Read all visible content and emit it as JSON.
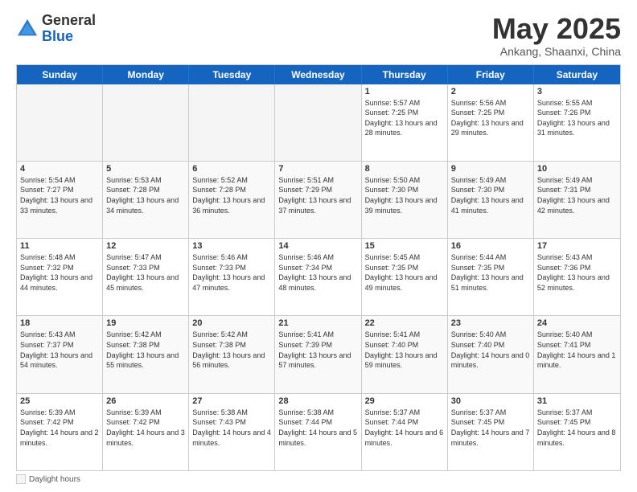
{
  "logo": {
    "general": "General",
    "blue": "Blue"
  },
  "title": "May 2025",
  "subtitle": "Ankang, Shaanxi, China",
  "dayHeaders": [
    "Sunday",
    "Monday",
    "Tuesday",
    "Wednesday",
    "Thursday",
    "Friday",
    "Saturday"
  ],
  "legend": "Daylight hours",
  "weeks": [
    [
      {
        "day": "",
        "info": "",
        "empty": true
      },
      {
        "day": "",
        "info": "",
        "empty": true
      },
      {
        "day": "",
        "info": "",
        "empty": true
      },
      {
        "day": "",
        "info": "",
        "empty": true
      },
      {
        "day": "1",
        "info": "Sunrise: 5:57 AM\nSunset: 7:25 PM\nDaylight: 13 hours\nand 28 minutes."
      },
      {
        "day": "2",
        "info": "Sunrise: 5:56 AM\nSunset: 7:25 PM\nDaylight: 13 hours\nand 29 minutes."
      },
      {
        "day": "3",
        "info": "Sunrise: 5:55 AM\nSunset: 7:26 PM\nDaylight: 13 hours\nand 31 minutes."
      }
    ],
    [
      {
        "day": "4",
        "info": "Sunrise: 5:54 AM\nSunset: 7:27 PM\nDaylight: 13 hours\nand 33 minutes."
      },
      {
        "day": "5",
        "info": "Sunrise: 5:53 AM\nSunset: 7:28 PM\nDaylight: 13 hours\nand 34 minutes."
      },
      {
        "day": "6",
        "info": "Sunrise: 5:52 AM\nSunset: 7:28 PM\nDaylight: 13 hours\nand 36 minutes."
      },
      {
        "day": "7",
        "info": "Sunrise: 5:51 AM\nSunset: 7:29 PM\nDaylight: 13 hours\nand 37 minutes."
      },
      {
        "day": "8",
        "info": "Sunrise: 5:50 AM\nSunset: 7:30 PM\nDaylight: 13 hours\nand 39 minutes."
      },
      {
        "day": "9",
        "info": "Sunrise: 5:49 AM\nSunset: 7:30 PM\nDaylight: 13 hours\nand 41 minutes."
      },
      {
        "day": "10",
        "info": "Sunrise: 5:49 AM\nSunset: 7:31 PM\nDaylight: 13 hours\nand 42 minutes."
      }
    ],
    [
      {
        "day": "11",
        "info": "Sunrise: 5:48 AM\nSunset: 7:32 PM\nDaylight: 13 hours\nand 44 minutes."
      },
      {
        "day": "12",
        "info": "Sunrise: 5:47 AM\nSunset: 7:33 PM\nDaylight: 13 hours\nand 45 minutes."
      },
      {
        "day": "13",
        "info": "Sunrise: 5:46 AM\nSunset: 7:33 PM\nDaylight: 13 hours\nand 47 minutes."
      },
      {
        "day": "14",
        "info": "Sunrise: 5:46 AM\nSunset: 7:34 PM\nDaylight: 13 hours\nand 48 minutes."
      },
      {
        "day": "15",
        "info": "Sunrise: 5:45 AM\nSunset: 7:35 PM\nDaylight: 13 hours\nand 49 minutes."
      },
      {
        "day": "16",
        "info": "Sunrise: 5:44 AM\nSunset: 7:35 PM\nDaylight: 13 hours\nand 51 minutes."
      },
      {
        "day": "17",
        "info": "Sunrise: 5:43 AM\nSunset: 7:36 PM\nDaylight: 13 hours\nand 52 minutes."
      }
    ],
    [
      {
        "day": "18",
        "info": "Sunrise: 5:43 AM\nSunset: 7:37 PM\nDaylight: 13 hours\nand 54 minutes."
      },
      {
        "day": "19",
        "info": "Sunrise: 5:42 AM\nSunset: 7:38 PM\nDaylight: 13 hours\nand 55 minutes."
      },
      {
        "day": "20",
        "info": "Sunrise: 5:42 AM\nSunset: 7:38 PM\nDaylight: 13 hours\nand 56 minutes."
      },
      {
        "day": "21",
        "info": "Sunrise: 5:41 AM\nSunset: 7:39 PM\nDaylight: 13 hours\nand 57 minutes."
      },
      {
        "day": "22",
        "info": "Sunrise: 5:41 AM\nSunset: 7:40 PM\nDaylight: 13 hours\nand 59 minutes."
      },
      {
        "day": "23",
        "info": "Sunrise: 5:40 AM\nSunset: 7:40 PM\nDaylight: 14 hours\nand 0 minutes."
      },
      {
        "day": "24",
        "info": "Sunrise: 5:40 AM\nSunset: 7:41 PM\nDaylight: 14 hours\nand 1 minute."
      }
    ],
    [
      {
        "day": "25",
        "info": "Sunrise: 5:39 AM\nSunset: 7:42 PM\nDaylight: 14 hours\nand 2 minutes."
      },
      {
        "day": "26",
        "info": "Sunrise: 5:39 AM\nSunset: 7:42 PM\nDaylight: 14 hours\nand 3 minutes."
      },
      {
        "day": "27",
        "info": "Sunrise: 5:38 AM\nSunset: 7:43 PM\nDaylight: 14 hours\nand 4 minutes."
      },
      {
        "day": "28",
        "info": "Sunrise: 5:38 AM\nSunset: 7:44 PM\nDaylight: 14 hours\nand 5 minutes."
      },
      {
        "day": "29",
        "info": "Sunrise: 5:37 AM\nSunset: 7:44 PM\nDaylight: 14 hours\nand 6 minutes."
      },
      {
        "day": "30",
        "info": "Sunrise: 5:37 AM\nSunset: 7:45 PM\nDaylight: 14 hours\nand 7 minutes."
      },
      {
        "day": "31",
        "info": "Sunrise: 5:37 AM\nSunset: 7:45 PM\nDaylight: 14 hours\nand 8 minutes."
      }
    ]
  ]
}
